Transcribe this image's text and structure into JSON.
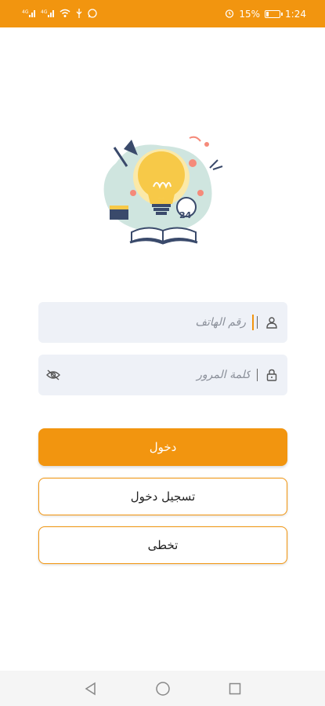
{
  "status_bar": {
    "signal1": "4G",
    "signal2": "4G",
    "battery_percent": "15%",
    "time": "1:24"
  },
  "colors": {
    "accent": "#f2950f",
    "field_bg": "#eef1f7"
  },
  "form": {
    "phone_placeholder": "رقم الهاتف",
    "password_placeholder": "كلمة المرور"
  },
  "buttons": {
    "login_label": "دخول",
    "register_label": "تسجيل دخول",
    "skip_label": "تخطى"
  },
  "icons": {
    "phone_field": "user-icon",
    "password_field": "lock-icon",
    "visibility_toggle": "eye-off-icon",
    "nav": [
      "back-icon",
      "home-icon",
      "recents-icon"
    ]
  }
}
